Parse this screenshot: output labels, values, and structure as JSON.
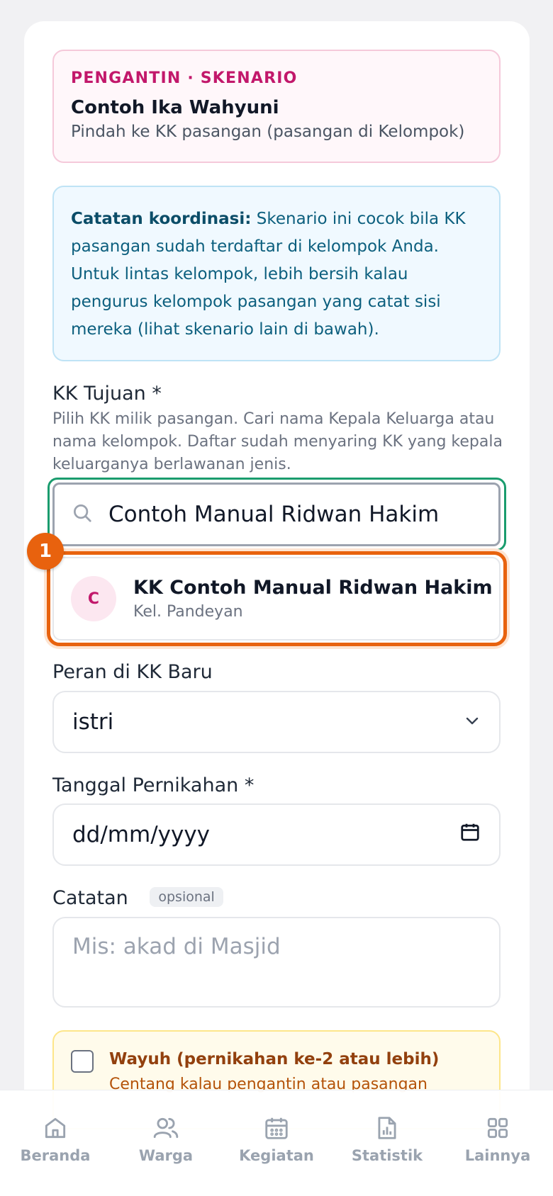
{
  "scenario": {
    "eyebrow": "PENGANTIN · SKENARIO",
    "name": "Contoh Ika Wahyuni",
    "subtitle": "Pindah ke KK pasangan (pasangan di Kelompok)"
  },
  "note": {
    "label": "Catatan koordinasi:",
    "text": "Skenario ini cocok bila KK pasangan sudah terdaftar di kelompok Anda. Untuk lintas kelompok, lebih bersih kalau pengurus kelompok pasangan yang catat sisi mereka (lihat skenario lain di bawah)."
  },
  "kk_tujuan": {
    "label": "KK Tujuan *",
    "helper": "Pilih KK milik pasangan. Cari nama Kepala Keluarga atau nama kelompok. Daftar sudah menyaring KK yang kepala keluarganya berlawanan jenis.",
    "search_value": "Contoh Manual Ridwan Hakim",
    "search_icon": "search-icon",
    "result": {
      "badge": "1",
      "avatar": "C",
      "name": "KK Contoh Manual Ridwan Hakim",
      "subtitle": "Kel. Pandeyan"
    }
  },
  "peran": {
    "label": "Peran di KK Baru",
    "value": "istri"
  },
  "tanggal": {
    "label": "Tanggal Pernikahan *",
    "placeholder": "dd/mm/yyyy"
  },
  "catatan": {
    "label": "Catatan",
    "tag": "opsional",
    "placeholder": "Mis: akad di Masjid"
  },
  "wayuh": {
    "title": "Wayuh (pernikahan ke-2 atau lebih)",
    "subtitle": "Centang kalau pengantin atau pasangan"
  },
  "nav": {
    "items": [
      {
        "label": "Beranda",
        "icon": "home-icon"
      },
      {
        "label": "Warga",
        "icon": "users-icon"
      },
      {
        "label": "Kegiatan",
        "icon": "calendar-icon"
      },
      {
        "label": "Statistik",
        "icon": "chart-icon"
      },
      {
        "label": "Lainnya",
        "icon": "grid-icon"
      }
    ]
  },
  "colors": {
    "accent_pink": "#c2186b",
    "focus_green": "#1a9c6e",
    "highlight_orange": "#e8620e"
  }
}
